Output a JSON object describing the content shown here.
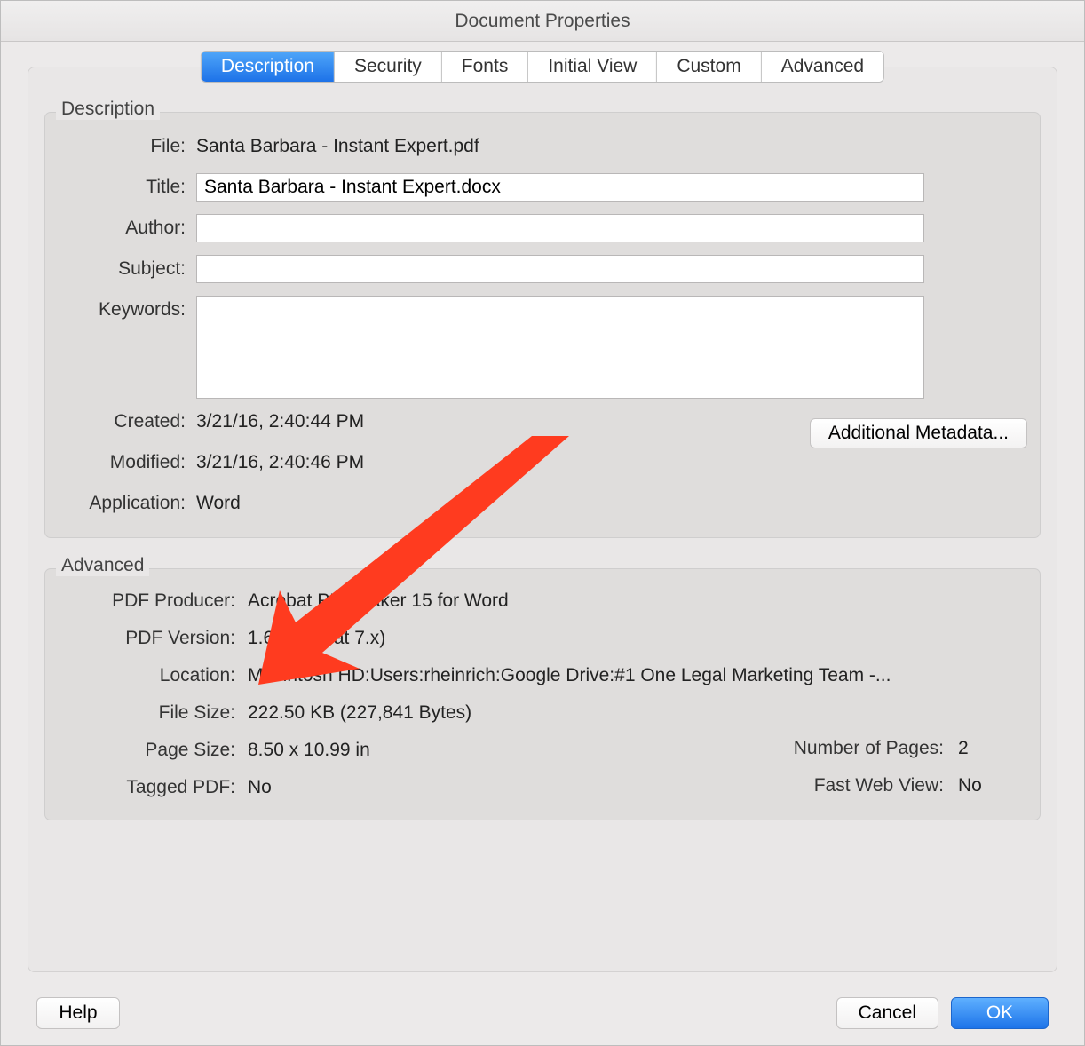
{
  "window": {
    "title": "Document Properties"
  },
  "tabs": {
    "description": "Description",
    "security": "Security",
    "fonts": "Fonts",
    "initial_view": "Initial View",
    "custom": "Custom",
    "advanced": "Advanced"
  },
  "description_group": {
    "heading": "Description",
    "labels": {
      "file": "File:",
      "title": "Title:",
      "author": "Author:",
      "subject": "Subject:",
      "keywords": "Keywords:",
      "created": "Created:",
      "modified": "Modified:",
      "application": "Application:"
    },
    "file_value": "Santa Barbara - Instant Expert.pdf",
    "title_value": "Santa Barbara - Instant Expert.docx",
    "author_value": "",
    "subject_value": "",
    "keywords_value": "",
    "created_value": "3/21/16, 2:40:44 PM",
    "modified_value": "3/21/16, 2:40:46 PM",
    "application_value": "Word",
    "additional_metadata_btn": "Additional Metadata..."
  },
  "advanced_group": {
    "heading": "Advanced",
    "labels": {
      "pdf_producer": "PDF Producer:",
      "pdf_version": "PDF Version:",
      "location": "Location:",
      "file_size": "File Size:",
      "page_size": "Page Size:",
      "number_of_pages": "Number of Pages:",
      "tagged_pdf": "Tagged PDF:",
      "fast_web_view": "Fast Web View:"
    },
    "pdf_producer_value": "Acrobat PDFMaker 15 for Word",
    "pdf_version_value": "1.6 (Acrobat 7.x)",
    "location_value": "Macintosh HD:Users:rheinrich:Google Drive:#1 One Legal Marketing Team -...",
    "file_size_value": "222.50 KB (227,841 Bytes)",
    "page_size_value": "8.50 x 10.99 in",
    "number_of_pages_value": "2",
    "tagged_pdf_value": "No",
    "fast_web_view_value": "No"
  },
  "footer": {
    "help": "Help",
    "cancel": "Cancel",
    "ok": "OK"
  },
  "annotation": {
    "arrow_color": "#ff3b1f"
  }
}
